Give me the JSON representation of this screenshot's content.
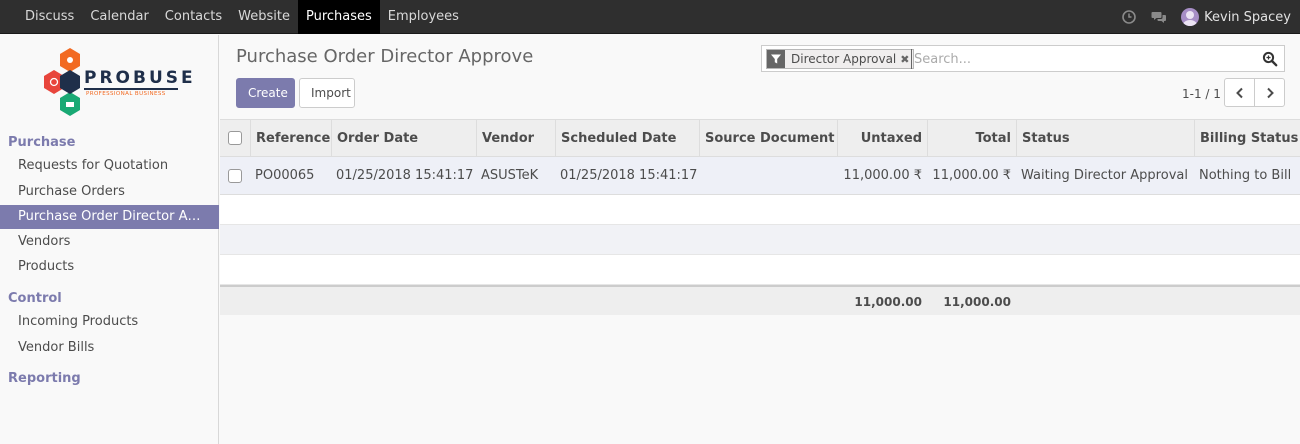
{
  "nav": {
    "items": [
      "Discuss",
      "Calendar",
      "Contacts",
      "Website",
      "Purchases",
      "Employees"
    ],
    "active": "Purchases",
    "user": "Kevin Spacey"
  },
  "sidebar": {
    "logo": {
      "word": "PROBUSE",
      "tagline": "PROFESSIONAL BUSINESS"
    },
    "sections": [
      {
        "title": "Purchase",
        "items": [
          "Requests for Quotation",
          "Purchase Orders",
          "Purchase Order Director A…",
          "Vendors",
          "Products"
        ]
      },
      {
        "title": "Control",
        "items": [
          "Incoming Products",
          "Vendor Bills"
        ]
      },
      {
        "title": "Reporting",
        "items": []
      }
    ],
    "active_item": "Purchase Order Director A…"
  },
  "page": {
    "title": "Purchase Order Director Approve",
    "create_label": "Create",
    "import_label": "Import"
  },
  "search": {
    "facet": "Director Approval",
    "placeholder": "Search..."
  },
  "pager": {
    "text": "1-1 / 1"
  },
  "table": {
    "headers": [
      "Reference",
      "Order Date",
      "Vendor",
      "Scheduled Date",
      "Source Document",
      "Untaxed",
      "Total",
      "Status",
      "Billing Status"
    ],
    "rows": [
      [
        "PO00065",
        "01/25/2018 15:41:17",
        "ASUSTeK",
        "01/25/2018 15:41:17",
        "",
        "11,000.00 ₹",
        "11,000.00 ₹",
        "Waiting Director Approval",
        "Nothing to Bill"
      ]
    ],
    "footer": {
      "untaxed": "11,000.00",
      "total": "11,000.00"
    }
  },
  "colors": {
    "accent": "#7c7bad",
    "navbar": "#2f2f2f",
    "logo_orange": "#f26a22",
    "logo_red": "#e8453c",
    "logo_green": "#19a974"
  }
}
